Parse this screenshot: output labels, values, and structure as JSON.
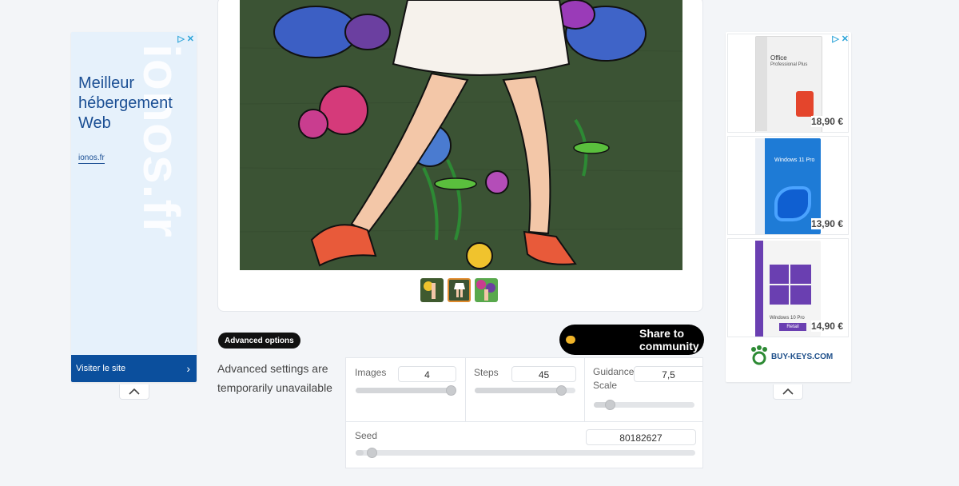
{
  "left_ad": {
    "watermark": "ionos.fr",
    "headline": "Meilleur hébergement Web",
    "domain": "ionos.fr",
    "cta": "Visiter le site"
  },
  "main": {
    "advanced_button": "Advanced options",
    "advanced_message": "Advanced settings are temporarily unavailable",
    "share_button": "Share to community",
    "thumbnails": [
      "thumb-1",
      "thumb-2",
      "thumb-3"
    ],
    "selected_thumbnail": 1
  },
  "settings": {
    "images": {
      "label": "Images",
      "value": "4",
      "fraction": 0.95
    },
    "steps": {
      "label": "Steps",
      "value": "45",
      "fraction": 0.85
    },
    "guidance": {
      "label": "Guidance Scale",
      "value": "7,5",
      "fraction": 0.12
    },
    "seed": {
      "label": "Seed",
      "value": "80182627",
      "fraction": 0.02
    }
  },
  "right_ad": {
    "products": [
      {
        "name": "Office Professional Plus",
        "price": "18,90 €",
        "color": "#f2f2f2"
      },
      {
        "name": "Windows 11 Pro",
        "price": "13,90 €",
        "color": "#1e7bd6"
      },
      {
        "name": "Windows 10 Pro Retail",
        "price": "14,90 €",
        "color": "#6a3fb1"
      }
    ],
    "brand": "BUY-KEYS.COM"
  }
}
